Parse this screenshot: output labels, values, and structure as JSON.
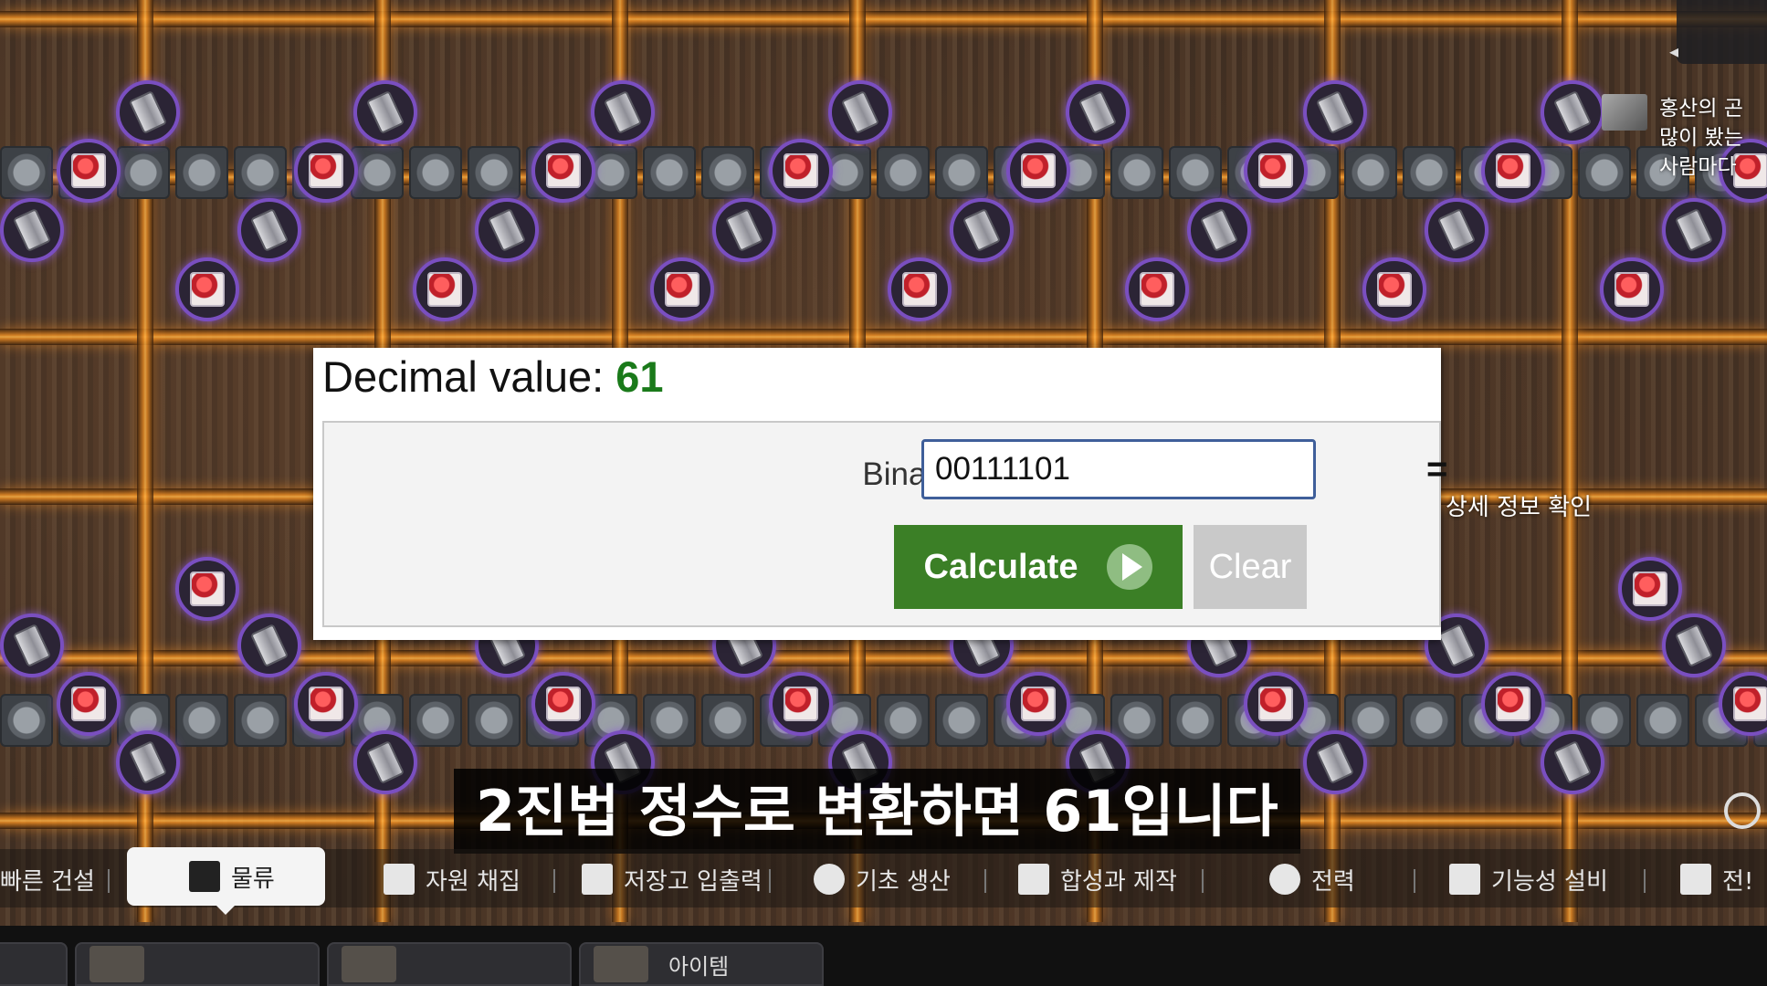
{
  "calculator": {
    "decimal_label": "Decimal value:",
    "decimal_value": "61",
    "binary_label": "Binary Value:",
    "binary_value": "00111101",
    "equals": "=",
    "calculate_label": "Calculate",
    "clear_label": "Clear"
  },
  "side": {
    "chat_lines": [
      "홍산의 곤",
      "많이 봤는",
      "사람마다"
    ],
    "detail_hint": "상세 정보 확인"
  },
  "subtitle": "2진법 정수로 변환하면 61입니다",
  "toolbar": {
    "tabs": [
      {
        "label": "빠른 건설",
        "icon": "quick-build-icon"
      },
      {
        "label": "물류",
        "icon": "logistics-icon"
      },
      {
        "label": "자원 채집",
        "icon": "pickaxe-icon"
      },
      {
        "label": "저장고 입출력",
        "icon": "storage-icon"
      },
      {
        "label": "기초 생산",
        "icon": "hexagon-icon"
      },
      {
        "label": "합성과 제작",
        "icon": "synthesis-icon"
      },
      {
        "label": "전력",
        "icon": "power-icon"
      },
      {
        "label": "기능성 설비",
        "icon": "hash-icon"
      },
      {
        "label": "전!",
        "icon": "tower-icon"
      }
    ],
    "selected": "물류"
  },
  "bottom_cards": [
    "",
    "",
    "",
    "아이템"
  ],
  "colors": {
    "decimal_value": "#1a7a1a",
    "calculate_button": "#3b7f26",
    "clear_button": "#c9c9c9",
    "input_border": "#3f5f9a",
    "belt_glow": "#e88a22",
    "token_ring": "#7a4fc0"
  }
}
